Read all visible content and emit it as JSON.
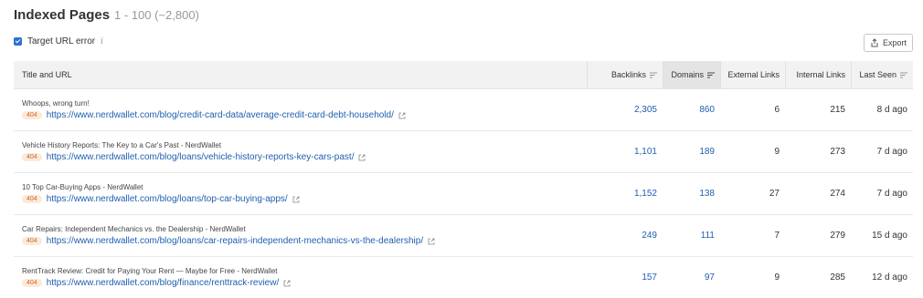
{
  "header": {
    "title": "Indexed Pages",
    "subtitle": "1 - 100 (~2,800)"
  },
  "filter": {
    "checkbox_label": "Target URL error",
    "checked": true,
    "info_glyph": "i"
  },
  "toolbar": {
    "export_label": "Export"
  },
  "table": {
    "columns": [
      "Title and URL",
      "Backlinks",
      "Domains",
      "External Links",
      "Internal Links",
      "Last Seen"
    ],
    "rows": [
      {
        "title": "Whoops, wrong turn!",
        "status": "404",
        "url": "https://www.nerdwallet.com/blog/credit-card-data/average-credit-card-debt-household/",
        "backlinks": "2,305",
        "domains": "860",
        "external_links": "6",
        "internal_links": "215",
        "last_seen": "8 d ago"
      },
      {
        "title": "Vehicle History Reports: The Key to a Car's Past - NerdWallet",
        "status": "404",
        "url": "https://www.nerdwallet.com/blog/loans/vehicle-history-reports-key-cars-past/",
        "backlinks": "1,101",
        "domains": "189",
        "external_links": "9",
        "internal_links": "273",
        "last_seen": "7 d ago"
      },
      {
        "title": "10 Top Car-Buying Apps - NerdWallet",
        "status": "404",
        "url": "https://www.nerdwallet.com/blog/loans/top-car-buying-apps/",
        "backlinks": "1,152",
        "domains": "138",
        "external_links": "27",
        "internal_links": "274",
        "last_seen": "7 d ago"
      },
      {
        "title": "Car Repairs: Independent Mechanics vs. the Dealership - NerdWallet",
        "status": "404",
        "url": "https://www.nerdwallet.com/blog/loans/car-repairs-independent-mechanics-vs-the-dealership/",
        "backlinks": "249",
        "domains": "111",
        "external_links": "7",
        "internal_links": "279",
        "last_seen": "15 d ago"
      },
      {
        "title": "RentTrack Review: Credit for Paying Your Rent — Maybe for Free - NerdWallet",
        "status": "404",
        "url": "https://www.nerdwallet.com/blog/finance/renttrack-review/",
        "backlinks": "157",
        "domains": "97",
        "external_links": "9",
        "internal_links": "285",
        "last_seen": "12 d ago"
      }
    ]
  },
  "colors": {
    "link": "#2060b0",
    "badge_text": "#c96a2a",
    "badge_bg": "#fde9d9",
    "header_bg": "#f2f2f2",
    "checkbox": "#2b6fd6"
  },
  "icons": {
    "sort": "sort-icon",
    "external_link": "external-link-icon",
    "export": "export-icon",
    "info": "info-icon"
  }
}
